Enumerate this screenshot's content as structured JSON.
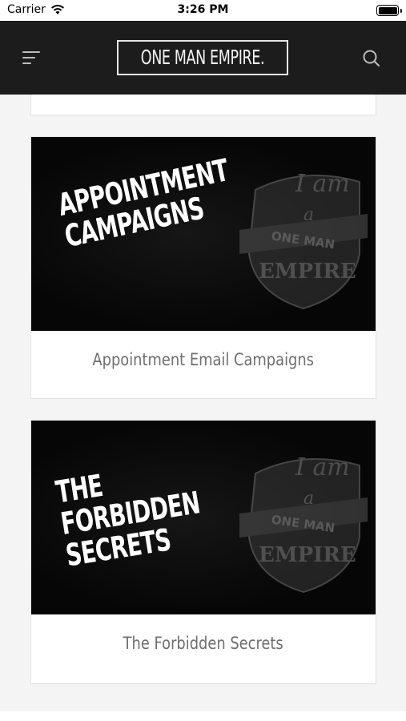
{
  "status_bar": {
    "carrier": "Carrier",
    "time": "3:26 PM"
  },
  "nav": {
    "logo_text": "ONE MAN EMPIRE.",
    "menu_icon": "menu-icon",
    "search_icon": "search-icon"
  },
  "colors": {
    "nav_bg": "#1c1c1c",
    "page_bg": "#f4f4f4",
    "caption": "#6e6e6e"
  },
  "cards": [
    {
      "headline_lines": [
        "APPOINTMENT",
        "CAMPAIGNS"
      ],
      "emblem_text": [
        "I am",
        "a",
        "ONE MAN",
        "EMPIRE"
      ],
      "title": "Appointment Email Campaigns"
    },
    {
      "headline_lines": [
        "THE",
        "FORBIDDEN",
        "SECRETS"
      ],
      "emblem_text": [
        "I am",
        "a",
        "ONE MAN",
        "EMPIRE"
      ],
      "title": "The Forbidden Secrets"
    }
  ]
}
